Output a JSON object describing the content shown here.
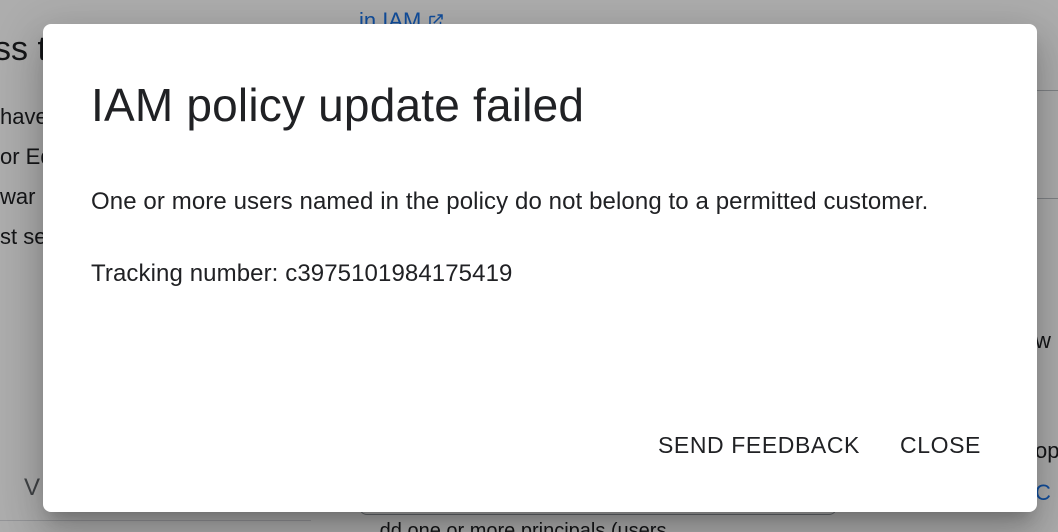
{
  "background": {
    "left_panel": {
      "title_fragment": "ss t",
      "lines": [
        "have",
        "or Ed",
        " war",
        "st se"
      ],
      "footer_letter": "V"
    },
    "right_panel": {
      "link_text": "in IAM",
      "edge_text_1": "w",
      "edge_text_2": "op",
      "edge_link": "C",
      "bottom_text": "...dd one or more principals (users..."
    }
  },
  "dialog": {
    "title": "IAM policy update failed",
    "message": "One or more users named in the policy do not belong to a permitted customer.",
    "tracking": "Tracking number: c3975101984175419",
    "actions": {
      "send_feedback": "SEND FEEDBACK",
      "close": "CLOSE"
    }
  }
}
